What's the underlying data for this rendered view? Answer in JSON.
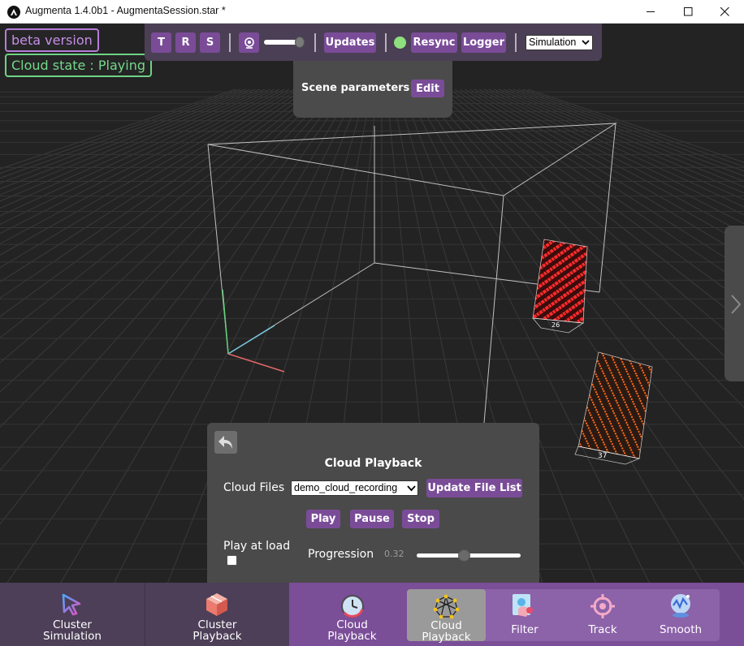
{
  "window": {
    "title": "Augmenta 1.4.0b1 - AugmentaSession.star *"
  },
  "badges": {
    "beta": "beta version",
    "cloud_state": "Cloud state : Playing"
  },
  "toolbar": {
    "t_label": "T",
    "r_label": "R",
    "s_label": "S",
    "updates_label": "Updates",
    "resync_label": "Resync",
    "logger_label": "Logger",
    "mode_selected": "Simulation",
    "status_color": "#8ee07f"
  },
  "scene_params": {
    "label": "Scene parameters :",
    "edit_label": "Edit"
  },
  "scene": {
    "object_labels": [
      "26",
      "37"
    ]
  },
  "playback": {
    "title": "Cloud Playback",
    "files_label": "Cloud Files",
    "selected_file": "demo_cloud_recording",
    "update_list_label": "Update File List",
    "play_label": "Play",
    "pause_label": "Pause",
    "stop_label": "Stop",
    "play_at_load_label": "Play at load",
    "play_at_load_checked": false,
    "progression_label": "Progression",
    "progression_value": "0.32",
    "progression_fraction": 0.32
  },
  "bottom_bar": {
    "cluster_sim": {
      "line1": "Cluster",
      "line2": "Simulation",
      "icon": "cursor-icon"
    },
    "cluster_playback": {
      "line1": "Cluster",
      "line2": "Playback",
      "icon": "cube-icon"
    },
    "cloud_playback_nav": {
      "line1": "Cloud",
      "line2": "Playback",
      "icon": "clock-icon"
    },
    "cloud_playback_tool": {
      "line1": "Cloud",
      "line2": "Playback",
      "icon": "point-cloud-icon"
    },
    "filter": {
      "label": "Filter",
      "icon": "filter-icon"
    },
    "track": {
      "label": "Track",
      "icon": "crosshair-icon"
    },
    "smooth": {
      "label": "Smooth",
      "icon": "smooth-icon"
    }
  },
  "colors": {
    "accent": "#7a4c98",
    "toolbar_bg": "#4b3f55",
    "bottom_active": "#7b4e98",
    "object_red": "#ff2b2b",
    "object_orange": "#ff6a1a"
  }
}
